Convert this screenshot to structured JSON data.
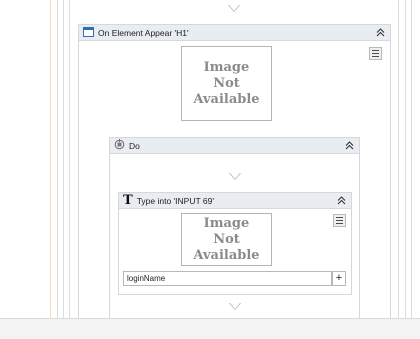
{
  "on_element_appear": {
    "title": "On Element Appear 'H1'",
    "image_placeholder": [
      "Image",
      "Not",
      "Available"
    ]
  },
  "do_block": {
    "title": "Do"
  },
  "type_into": {
    "title": "Type into 'INPUT  69'",
    "image_placeholder": [
      "Image",
      "Not",
      "Available"
    ],
    "text_value": "loginName",
    "add_button_label": "+"
  },
  "icons": {
    "on_element_appear": "window-icon",
    "do": "sequence-icon",
    "type_into": "type-T-icon",
    "collapse": "double-chevron-up-icon",
    "menu": "hamburger-menu-icon"
  },
  "colors": {
    "header_bg": "#e9ecf0",
    "border": "#d4d8de",
    "arrow": "#9fb0c2",
    "placeholder_text": "#8a8a8a"
  }
}
